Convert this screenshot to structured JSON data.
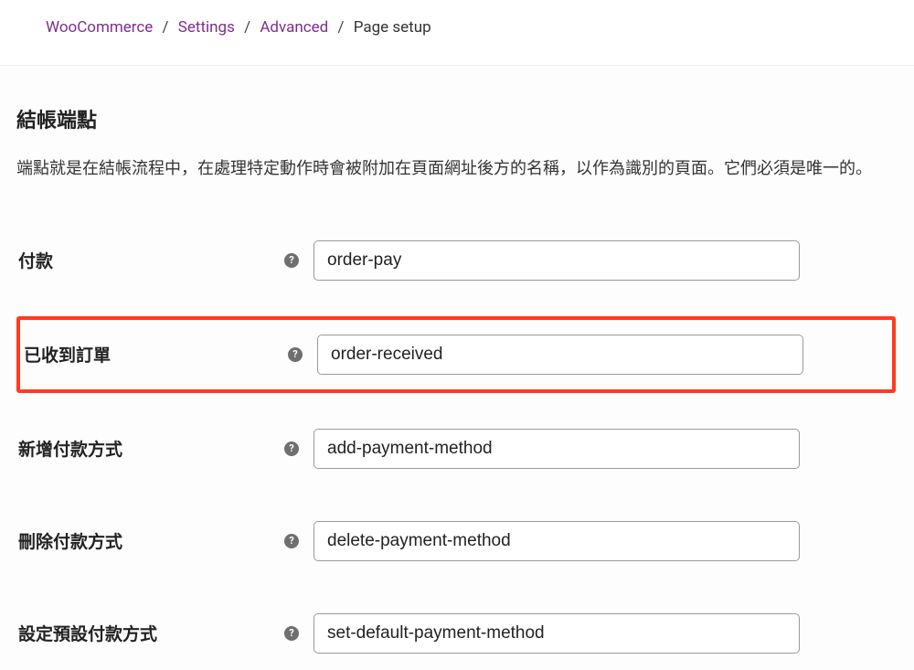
{
  "breadcrumb": {
    "items": [
      {
        "label": "WooCommerce"
      },
      {
        "label": "Settings"
      },
      {
        "label": "Advanced"
      }
    ],
    "current": "Page setup",
    "sep": "/"
  },
  "section": {
    "title": "結帳端點",
    "description": "端點就是在結帳流程中，在處理特定動作時會被附加在頁面網址後方的名稱，以作為識別的頁面。它們必須是唯一的。"
  },
  "help_glyph": "?",
  "fields": [
    {
      "label": "付款",
      "value": "order-pay"
    },
    {
      "label": "已收到訂單",
      "value": "order-received"
    },
    {
      "label": "新增付款方式",
      "value": "add-payment-method"
    },
    {
      "label": "刪除付款方式",
      "value": "delete-payment-method"
    },
    {
      "label": "設定預設付款方式",
      "value": "set-default-payment-method"
    }
  ]
}
